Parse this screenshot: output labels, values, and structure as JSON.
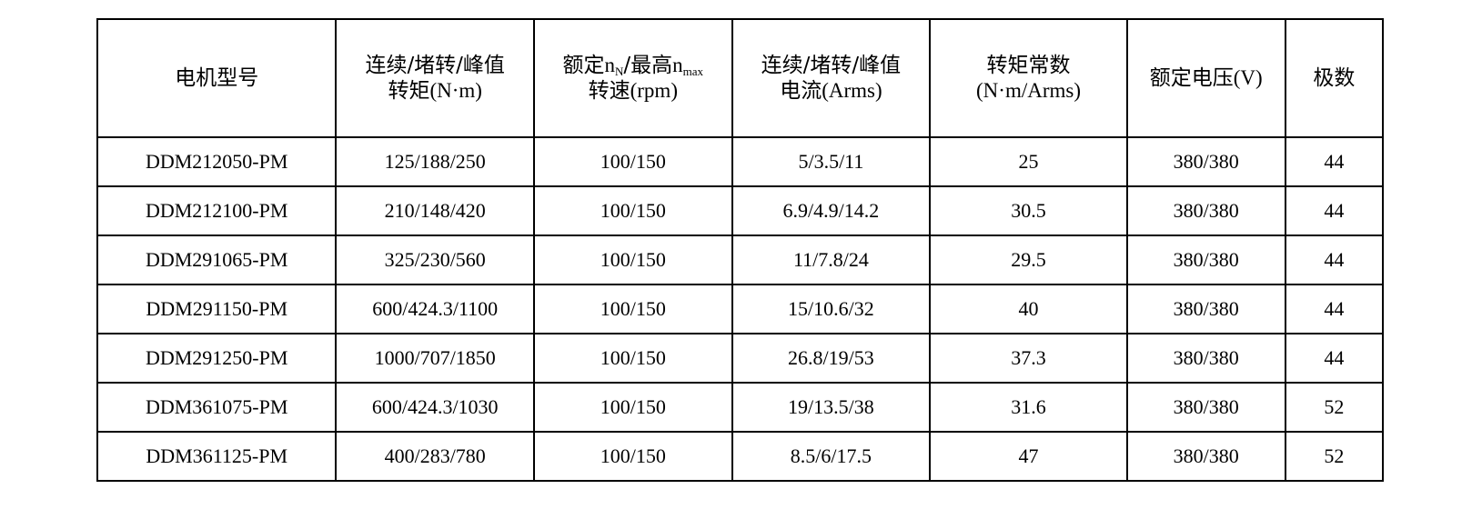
{
  "table": {
    "headers": {
      "model": "电机型号",
      "torque_line1": "连续/堵转/峰值",
      "torque_line2_cn": "转矩",
      "torque_line2_unit": "(N·m)",
      "speed_pre": "额定",
      "speed_n1": "n",
      "speed_n1_sub": "N",
      "speed_mid": "/最高",
      "speed_n2": "n",
      "speed_n2_sub": "max",
      "speed_line2_cn": "转速",
      "speed_line2_unit": "(rpm)",
      "current_line1": "连续/堵转/峰值",
      "current_line2_cn": "电流",
      "current_line2_unit": "(Arms)",
      "kt_line1": "转矩常数",
      "kt_line2": "(N·m/Arms)",
      "voltage_cn": "额定电压",
      "voltage_unit": "(V)",
      "poles": "极数"
    },
    "rows": [
      [
        "DDM212050-PM",
        "125/188/250",
        "100/150",
        "5/3.5/11",
        "25",
        "380/380",
        "44"
      ],
      [
        "DDM212100-PM",
        "210/148/420",
        "100/150",
        "6.9/4.9/14.2",
        "30.5",
        "380/380",
        "44"
      ],
      [
        "DDM291065-PM",
        "325/230/560",
        "100/150",
        "11/7.8/24",
        "29.5",
        "380/380",
        "44"
      ],
      [
        "DDM291150-PM",
        "600/424.3/1100",
        "100/150",
        "15/10.6/32",
        "40",
        "380/380",
        "44"
      ],
      [
        "DDM291250-PM",
        "1000/707/1850",
        "100/150",
        "26.8/19/53",
        "37.3",
        "380/380",
        "44"
      ],
      [
        "DDM361075-PM",
        "600/424.3/1030",
        "100/150",
        "19/13.5/38",
        "31.6",
        "380/380",
        "52"
      ],
      [
        "DDM361125-PM",
        "400/283/780",
        "100/150",
        "8.5/6/17.5",
        "47",
        "380/380",
        "52"
      ]
    ]
  }
}
